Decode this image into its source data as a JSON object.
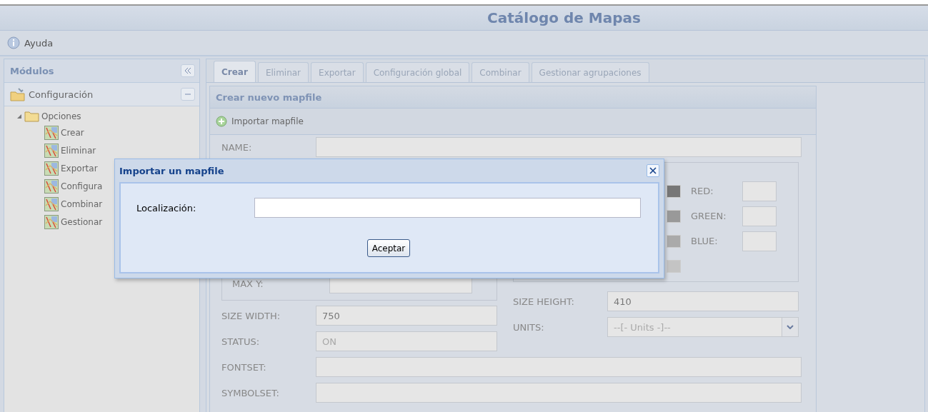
{
  "header": {
    "title": "Catálogo de Mapas"
  },
  "toolbar": {
    "help": "Ayuda"
  },
  "sidebar": {
    "title": "Módulos",
    "section": {
      "label": "Configuración",
      "expanded": true
    },
    "tree": {
      "label": "Opciones",
      "expanded": true,
      "children": [
        {
          "label": "Crear"
        },
        {
          "label": "Eliminar"
        },
        {
          "label": "Exportar"
        },
        {
          "label": "Configura"
        },
        {
          "label": "Combinar"
        },
        {
          "label": "Gestionar"
        }
      ]
    }
  },
  "tabs": [
    {
      "label": "Crear",
      "selected": true
    },
    {
      "label": "Eliminar",
      "selected": false
    },
    {
      "label": "Exportar",
      "selected": false
    },
    {
      "label": "Configuración global",
      "selected": false
    },
    {
      "label": "Combinar",
      "selected": false
    },
    {
      "label": "Gestionar agrupaciones",
      "selected": false
    }
  ],
  "panel": {
    "title": "Crear nuevo mapfile",
    "toolbar_button": "Importar mapfile",
    "name_label": "NAME:",
    "extent_label": "MAX Y:",
    "colors": [
      {
        "label": "RED:"
      },
      {
        "label": "GREEN:"
      },
      {
        "label": "BLUE:"
      }
    ],
    "size_width": {
      "label": "SIZE WIDTH:",
      "value": "750"
    },
    "size_height": {
      "label": "SIZE HEIGHT:",
      "value": "410"
    },
    "status": {
      "label": "STATUS:",
      "value": "ON",
      "disabled": true
    },
    "units": {
      "label": "UNITS:",
      "placeholder": "--[- Units -]--"
    },
    "fontset": {
      "label": "FONTSET:"
    },
    "symbolset": {
      "label": "SYMBOLSET:"
    }
  },
  "dialog": {
    "title": "Importar un mapfile",
    "field_label": "Localización:",
    "button": "Aceptar"
  }
}
